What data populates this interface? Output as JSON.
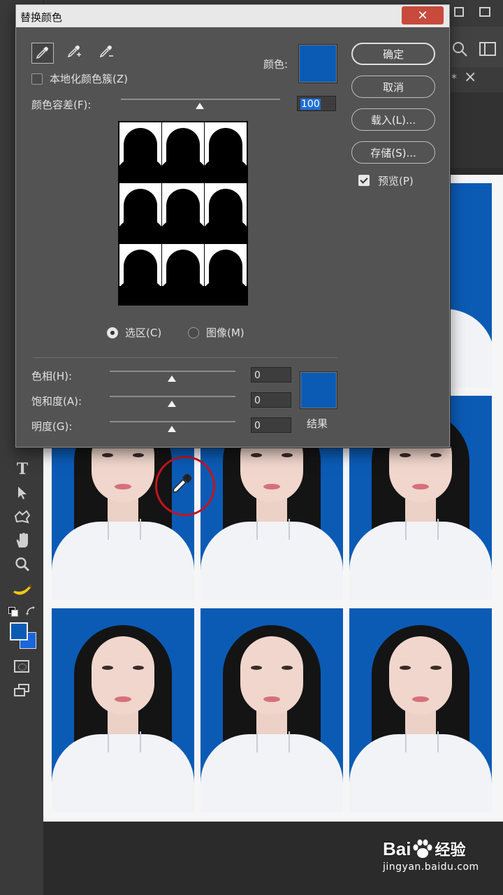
{
  "dialog": {
    "title": "替换颜色",
    "close_glyph": "✕",
    "localize_label": "本地化颜色簇(Z)",
    "localize_checked": false,
    "color_label": "颜色:",
    "color_swatch": "#0b5bb5",
    "fuzziness_label": "颜色容差(F):",
    "fuzziness_value": "100",
    "view_options": [
      {
        "label": "选区(C)",
        "selected": true
      },
      {
        "label": "图像(M)",
        "selected": false
      }
    ],
    "hue_label": "色相(H):",
    "hue_value": "0",
    "saturation_label": "饱和度(A):",
    "saturation_value": "0",
    "lightness_label": "明度(G):",
    "lightness_value": "0",
    "result_label": "结果",
    "result_swatch": "#0b5bb5",
    "buttons": {
      "ok": "确定",
      "cancel": "取消",
      "load": "载入(L)...",
      "save": "存储(S)..."
    },
    "preview_label": "预览(P)",
    "preview_checked": true
  },
  "tab": {
    "marker": "*",
    "close_glyph": "×"
  },
  "toolbar": {
    "icons": [
      "type-tool-icon",
      "path-selection-icon",
      "shape-tool-icon",
      "hand-tool-icon",
      "zoom-tool-icon",
      "banana-icon",
      "default-colors-icon",
      "swap-colors-icon",
      "quick-mask-icon",
      "screen-mode-icon"
    ],
    "type_glyph": "T"
  },
  "colors": {
    "foreground": "#0b5bb5",
    "background": "#1a66d9",
    "photo_bg": "#0b5bb5",
    "cursor_ring": "#c5141d"
  },
  "watermark": {
    "brand_left": "Bai",
    "brand_right": "经验",
    "url": "jingyan.baidu.com"
  }
}
